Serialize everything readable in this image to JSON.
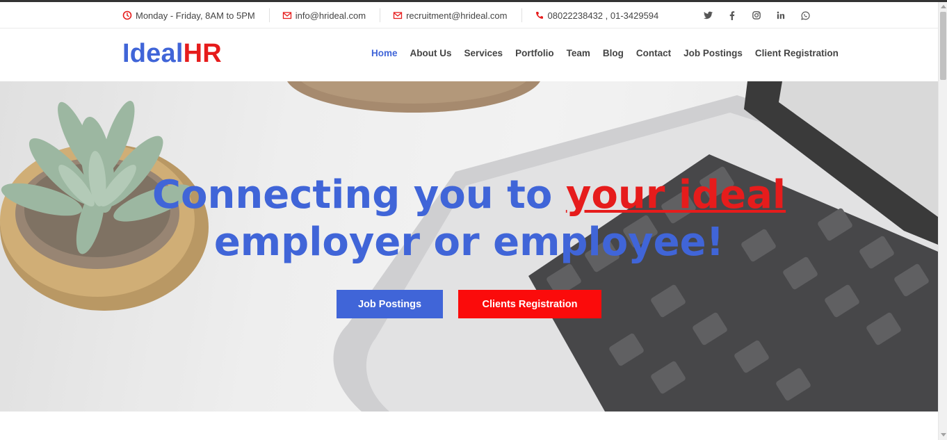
{
  "topbar": {
    "hours": "Monday - Friday, 8AM to 5PM",
    "email": "info@hrideal.com",
    "recruitment_email": "recruitment@hrideal.com",
    "phone": "08022238432 , 01-3429594",
    "socials": [
      "twitter-icon",
      "facebook-icon",
      "instagram-icon",
      "linkedin-icon",
      "whatsapp-icon"
    ]
  },
  "logo": {
    "part1": "Ideal",
    "part2": "HR"
  },
  "nav": {
    "items": [
      "Home",
      "About Us",
      "Services",
      "Portfolio",
      "Team",
      "Blog",
      "Contact",
      "Job Postings",
      "Client Registration"
    ],
    "active": "Home"
  },
  "hero": {
    "title_part1": "Connecting you to ",
    "title_highlight": "your ideal",
    "title_line2": "employer or employee!",
    "button_job": "Job Postings",
    "button_clients": "Clients Registration"
  },
  "colors": {
    "brand_blue": "#4065d8",
    "brand_red": "#e61c1c",
    "button_red": "#fb0b0b",
    "icon_red": "#e61c1c",
    "text_gray": "#444444"
  }
}
